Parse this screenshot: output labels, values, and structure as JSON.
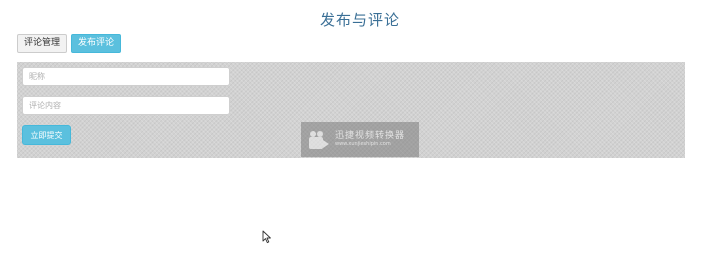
{
  "page": {
    "title": "发布与评论"
  },
  "tabs": [
    {
      "label": "评论管理",
      "active": false
    },
    {
      "label": "发布评论",
      "active": true
    }
  ],
  "form": {
    "nickname": {
      "placeholder": "昵称",
      "value": ""
    },
    "comment": {
      "placeholder": "评论内容",
      "value": ""
    },
    "submit_label": "立即提交"
  },
  "watermark": {
    "title": "迅捷视频转换器",
    "url": "www.xunjieshipin.com"
  },
  "colors": {
    "accent": "#5bc0de",
    "title": "#3a6f96",
    "panel": "#d2d2d2"
  }
}
